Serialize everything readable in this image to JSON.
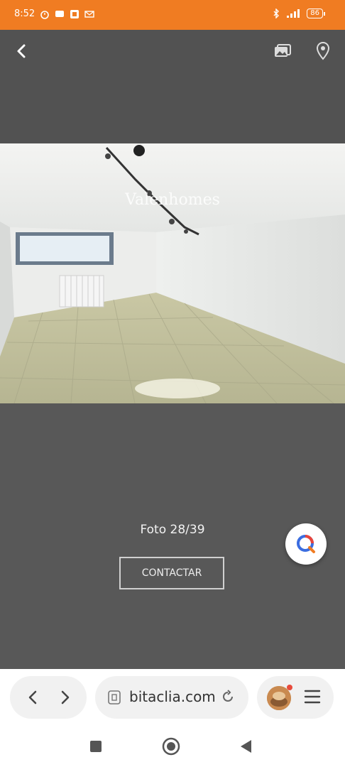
{
  "status_bar": {
    "time": "8:52",
    "battery": "86",
    "left_icons": [
      "alarm-icon",
      "message-icon",
      "app-icon",
      "mail-icon"
    ],
    "right_icons": [
      "bluetooth-icon",
      "signal-icon",
      "battery-icon"
    ]
  },
  "top_bar": {
    "back_icon": "chevron-left-icon",
    "gallery_icon": "gallery-icon",
    "map_icon": "location-pin-icon"
  },
  "photo": {
    "watermark": "Valenhomes"
  },
  "gallery": {
    "photo_count": "Foto 28/39",
    "contact_label": "CONTACTAR"
  },
  "browser": {
    "url": "bitaclia.com",
    "back_icon": "chevron-left-icon",
    "forward_icon": "chevron-right-icon",
    "menu_icon": "hamburger-icon"
  },
  "colors": {
    "status_bar": "#f07c22",
    "background": "#585858",
    "top_bar": "#525252"
  }
}
